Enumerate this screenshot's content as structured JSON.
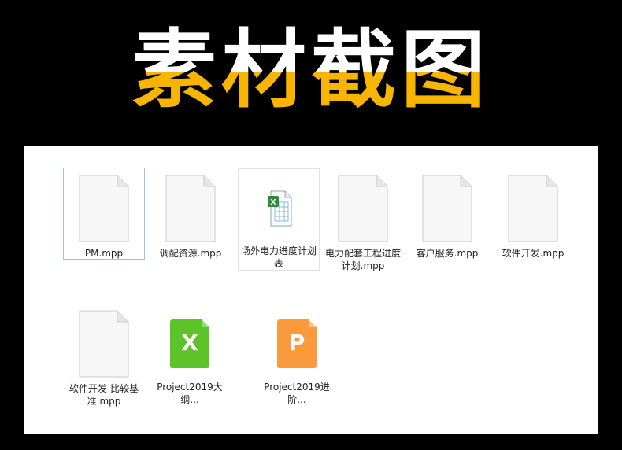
{
  "banner": {
    "title": "素材截图"
  },
  "files": [
    {
      "name": "PM.mpp",
      "icon": "blank-document-icon"
    },
    {
      "name": "调配资源.mpp",
      "icon": "blank-document-icon"
    },
    {
      "name": "场外电力进度计划表",
      "icon": "spreadsheet-document-icon"
    },
    {
      "name": "电力配套工程进度计划.mpp",
      "icon": "blank-document-icon"
    },
    {
      "name": "客户服务.mpp",
      "icon": "blank-document-icon"
    },
    {
      "name": "软件开发.mpp",
      "icon": "blank-document-icon"
    },
    {
      "name": "软件开发-比较基准.mpp",
      "icon": "blank-document-icon"
    },
    {
      "name": "Project2019大纲...",
      "icon": "excel-tile-icon",
      "letter": "X"
    },
    {
      "name": "Project2019进阶...",
      "icon": "ppt-tile-icon",
      "letter": "P"
    }
  ],
  "colors": {
    "banner_top": "#ffffff",
    "banner_bottom": "#f7b500",
    "excel_green": "#5cc42a",
    "ppt_orange": "#f99a3c",
    "selection_border": "#99c3e8"
  }
}
